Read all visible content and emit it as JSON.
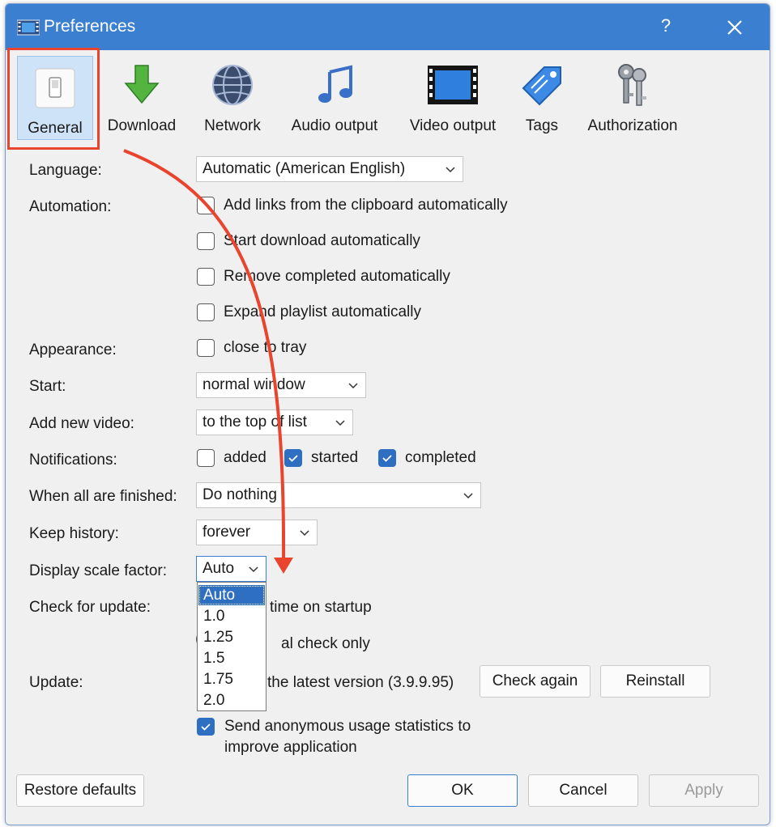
{
  "window": {
    "title": "Preferences",
    "help_glyph": "?",
    "close_icon": "close-icon"
  },
  "toolbar": [
    {
      "label": "General",
      "icon": "toggle-switch-icon",
      "selected": true
    },
    {
      "label": "Download",
      "icon": "download-arrow-icon"
    },
    {
      "label": "Network",
      "icon": "globe-icon"
    },
    {
      "label": "Audio output",
      "icon": "music-note-icon"
    },
    {
      "label": "Video output",
      "icon": "film-strip-icon"
    },
    {
      "label": "Tags",
      "icon": "tag-icon"
    },
    {
      "label": "Authorization",
      "icon": "keys-icon"
    }
  ],
  "settings": {
    "language": {
      "label": "Language:",
      "value": "Automatic (American English)"
    },
    "automation": {
      "label": "Automation:",
      "options": [
        {
          "label": "Add links from the clipboard automatically",
          "checked": false
        },
        {
          "label": "Start download automatically",
          "checked": false
        },
        {
          "label": "Remove completed automatically",
          "checked": false
        },
        {
          "label": "Expand playlist automatically",
          "checked": false
        }
      ]
    },
    "appearance": {
      "label": "Appearance:",
      "option": "close to tray",
      "checked": false
    },
    "start": {
      "label": "Start:",
      "value": "normal window"
    },
    "add_new_video": {
      "label": "Add new video:",
      "value": "to the top of list"
    },
    "notifications": {
      "label": "Notifications:",
      "options": [
        {
          "label": "added",
          "checked": false
        },
        {
          "label": "started",
          "checked": true
        },
        {
          "label": "completed",
          "checked": true
        }
      ]
    },
    "when_finished": {
      "label": "When all are finished:",
      "value": "Do nothing"
    },
    "keep_history": {
      "label": "Keep history:",
      "value": "forever"
    },
    "display_scale": {
      "label": "Display scale factor:",
      "value": "Auto",
      "options": [
        "Auto",
        "1.0",
        "1.25",
        "1.5",
        "1.75",
        "2.0"
      ]
    },
    "check_update": {
      "label": "Check for update:",
      "option1": "time on startup",
      "option2": "al check only"
    },
    "update": {
      "label": "Update:",
      "status": "the latest version (3.9.9.95)",
      "check_again": "Check again",
      "reinstall": "Reinstall"
    },
    "stats": {
      "label_line1": "Send anonymous usage statistics to",
      "label_line2": "improve application",
      "checked": true
    }
  },
  "footer": {
    "restore": "Restore defaults",
    "ok": "OK",
    "cancel": "Cancel",
    "apply": "Apply"
  },
  "annotation": {
    "color": "#e8442e"
  }
}
